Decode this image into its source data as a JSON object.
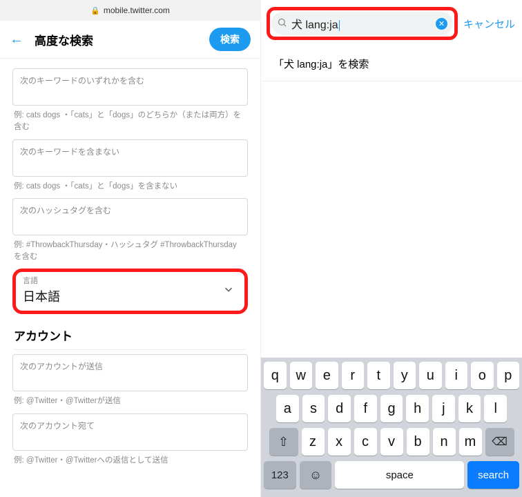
{
  "left": {
    "url": "mobile.twitter.com",
    "header": {
      "title": "高度な検索",
      "search_button": "検索"
    },
    "fields": [
      {
        "placeholder": "次のキーワードのいずれかを含む",
        "hint": "例: cats dogs ・「cats」と「dogs」のどちらか（または両方）を含む"
      },
      {
        "placeholder": "次のキーワードを含まない",
        "hint": "例: cats dogs ・「cats」と「dogs」を含まない"
      },
      {
        "placeholder": "次のハッシュタグを含む",
        "hint": "例: #ThrowbackThursday・ハッシュタグ #ThrowbackThursday を含む"
      }
    ],
    "language": {
      "label": "言語",
      "value": "日本語"
    },
    "accounts_title": "アカウント",
    "account_fields": [
      {
        "placeholder": "次のアカウントが送信",
        "hint": "例: @Twitter・@Twitterが送信"
      },
      {
        "placeholder": "次のアカウント宛て",
        "hint": "例: @Twitter・@Twitterへの返信として送信"
      }
    ]
  },
  "right": {
    "search_value": "犬 lang:ja",
    "cancel": "キャンセル",
    "suggestion": "「犬 lang:ja」を検索",
    "keyboard": {
      "row1": [
        "q",
        "w",
        "e",
        "r",
        "t",
        "y",
        "u",
        "i",
        "o",
        "p"
      ],
      "row2": [
        "a",
        "s",
        "d",
        "f",
        "g",
        "h",
        "j",
        "k",
        "l"
      ],
      "row3": [
        "z",
        "x",
        "c",
        "v",
        "b",
        "n",
        "m"
      ],
      "shift": "⇧",
      "backspace": "⌫",
      "num": "123",
      "emoji": "☺",
      "space": "space",
      "search": "search"
    }
  }
}
